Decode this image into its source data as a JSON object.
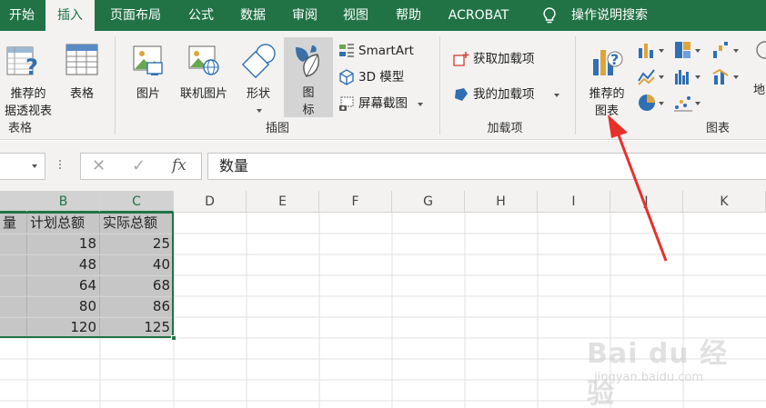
{
  "tabs": [
    "开始",
    "插入",
    "页面布局",
    "公式",
    "数据",
    "审阅",
    "视图",
    "帮助",
    "ACROBAT"
  ],
  "active_tab": "插入",
  "tell_me": "操作说明搜索",
  "ribbon": {
    "tables_group": {
      "label": "表格",
      "pivot_line1": "推荐的",
      "pivot_line2": "据透视表",
      "table": "表格"
    },
    "illustrations_group": {
      "label": "插图",
      "pictures": "图片",
      "online_pictures": "联机图片",
      "shapes": "形状",
      "icons_line1": "图",
      "icons_line2": "标",
      "smartart": "SmartArt",
      "model3d": "3D 模型",
      "screenshot": "屏幕截图"
    },
    "addins_group": {
      "label": "加载项",
      "get_addins": "获取加载项",
      "my_addins": "我的加载项"
    },
    "charts_group": {
      "label": "图表",
      "recommended_line1": "推荐的",
      "recommended_line2": "图表",
      "cut_label": "地"
    }
  },
  "formula_bar": {
    "cancel_glyph": "✕",
    "enter_glyph": "✓",
    "fx_glyph": "fx",
    "value": "数量"
  },
  "columns": [
    "B",
    "C",
    "D",
    "E",
    "F",
    "G",
    "H",
    "I",
    "J",
    "K"
  ],
  "table": {
    "header_a": "量",
    "header_b": "计划总额",
    "header_c": "实际总额",
    "rows": [
      [
        "18",
        "25"
      ],
      [
        "48",
        "40"
      ],
      [
        "64",
        "68"
      ],
      [
        "80",
        "86"
      ],
      [
        "120",
        "125"
      ]
    ]
  },
  "colors": {
    "accent": "#217346",
    "selection_fill": "#c6c6c6",
    "annotation_arrow": "#e8302b"
  },
  "watermark": {
    "brand": "Bai du 经验",
    "url": "jingyan.baidu.com"
  }
}
